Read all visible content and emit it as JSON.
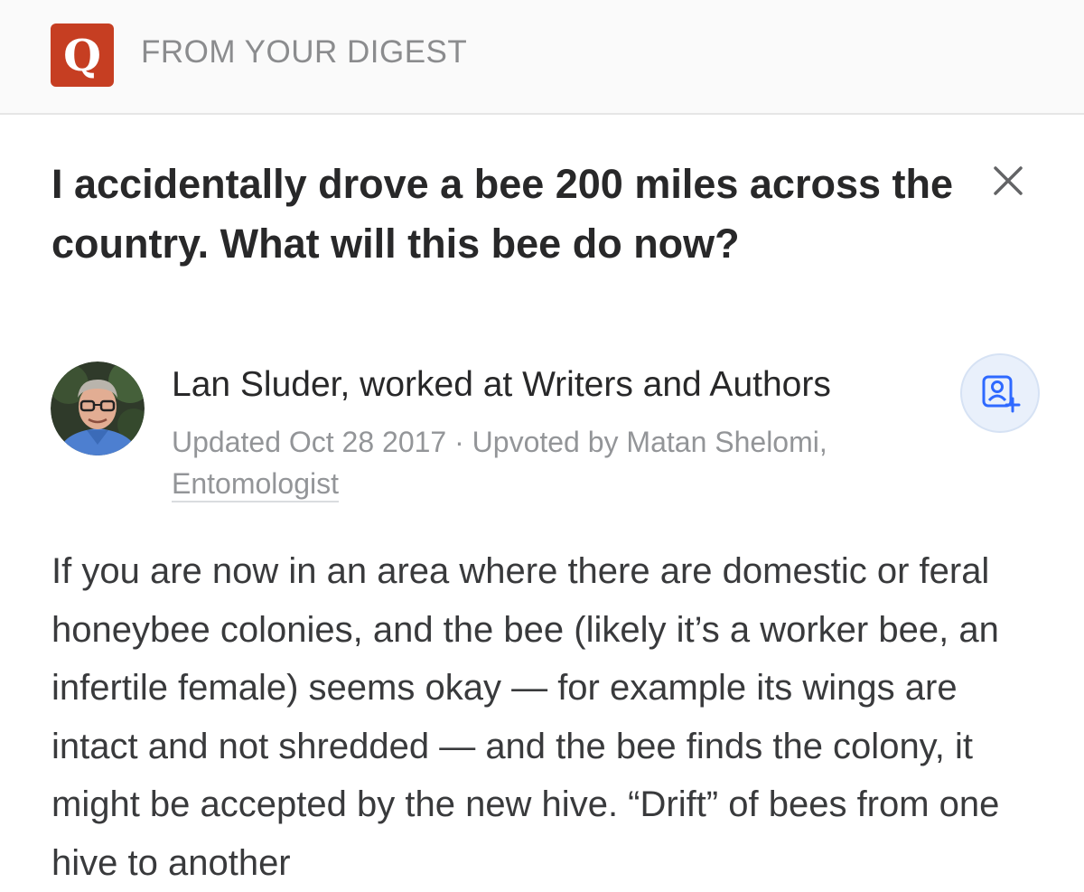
{
  "header": {
    "logo_letter": "Q",
    "label": "FROM YOUR DIGEST"
  },
  "question": {
    "title": "I accidentally drove a bee 200 miles across the country. What will this bee do now?"
  },
  "answer": {
    "author_line": "Lan Sluder, worked at Writers and Authors",
    "updated": "Updated Oct 28 2017",
    "separator": "·",
    "upvoted_prefix": "Upvoted by",
    "upvoter_name": "Matan Shelomi,",
    "upvoter_credential": "Entomologist",
    "body": "If you are now in an area where there are domestic or feral honeybee colonies, and the bee (likely it’s a worker bee, an infertile female) seems okay — for example its wings are intact and not shredded — and the bee finds the colony, it might be accepted by the new hive. “Drift” of bees from one hive to another"
  },
  "icons": {
    "logo": "quora-logo-icon",
    "close": "close-icon",
    "follow": "add-person-icon"
  },
  "colors": {
    "brand": "#c63e22",
    "header_bg": "#fafafa",
    "muted_text": "#939598",
    "follow_bg": "#e9f0fb",
    "follow_icon": "#2e69ff"
  }
}
